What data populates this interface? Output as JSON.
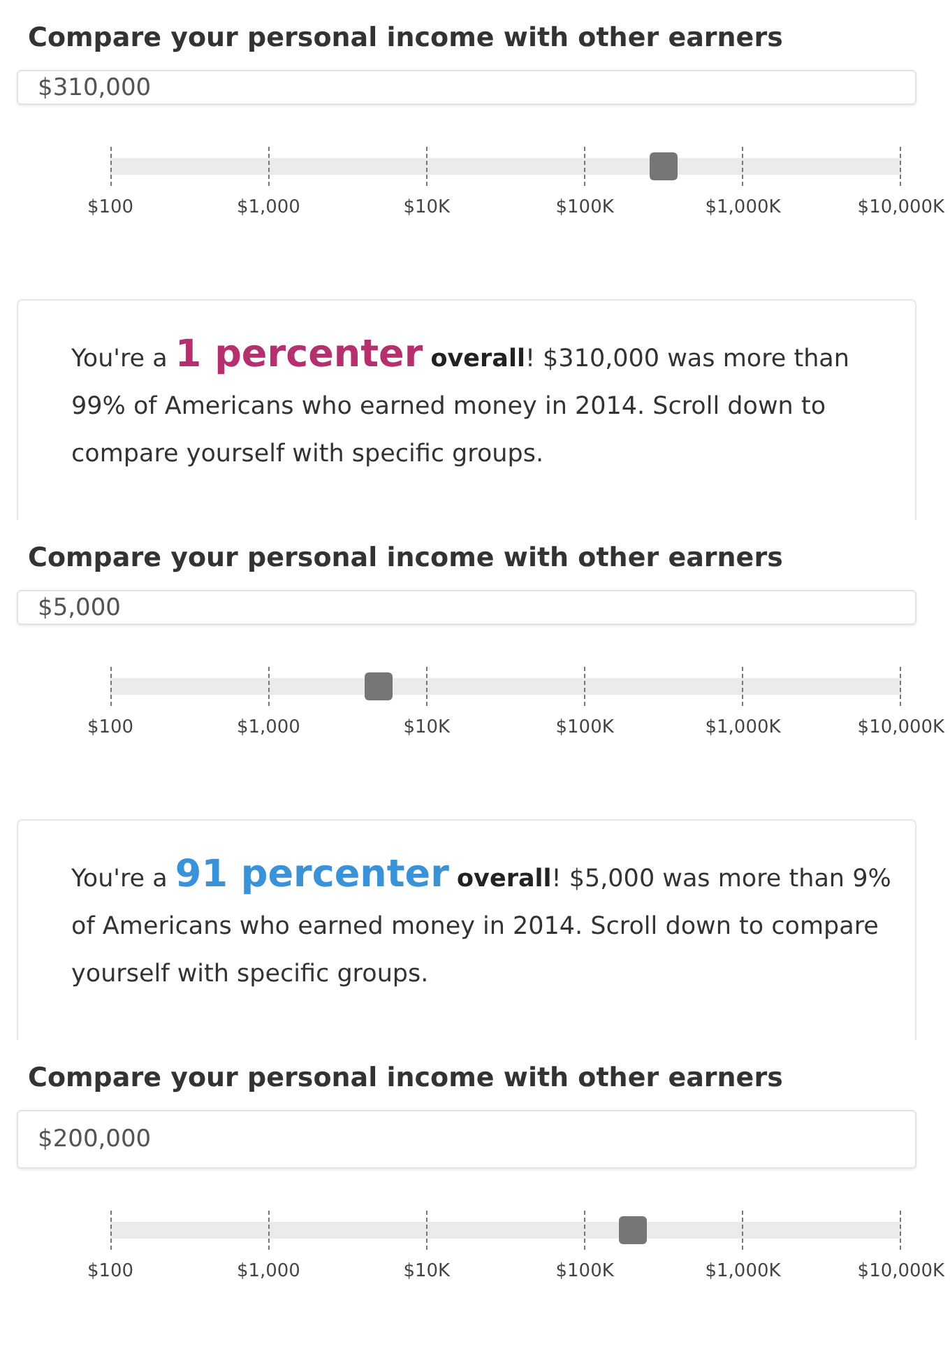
{
  "panels": [
    {
      "heading": "Compare your personal income with other earners",
      "income_value": "$310,000",
      "slider": {
        "level": 0.7,
        "ticks": [
          "$100",
          "$1,000",
          "$10K",
          "$100K",
          "$1,000K",
          "$10,000K"
        ]
      },
      "result": {
        "lead": "You're a",
        "highlight": "1 percenter",
        "color": "#b5306f",
        "emphasis": "overall",
        "rest": "! $310,000 was more than 99% of Americans who earned money in 2014. Scroll down to compare yourself with specific groups."
      }
    },
    {
      "heading": "Compare your personal income with other earners",
      "income_value": "$5,000",
      "slider": {
        "level": 0.34,
        "ticks": [
          "$100",
          "$1,000",
          "$10K",
          "$100K",
          "$1,000K",
          "$10,000K"
        ]
      },
      "result": {
        "lead": "You're a",
        "highlight": "91 percenter",
        "color": "#3a92d8",
        "emphasis": "overall",
        "rest": "! $5,000 was more than 9% of Americans who earned money in 2014. Scroll down to compare yourself with specific groups."
      }
    },
    {
      "heading": "Compare your personal income with other earners",
      "income_value": "$200,000",
      "slider": {
        "level": 0.66,
        "ticks": [
          "$100",
          "$1,000",
          "$10K",
          "$100K",
          "$1,000K",
          "$10,000K"
        ]
      }
    }
  ]
}
